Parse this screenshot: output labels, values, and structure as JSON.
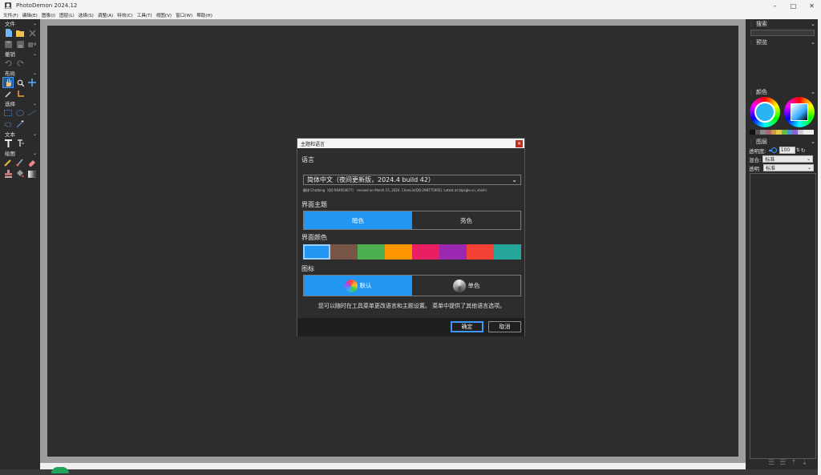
{
  "window": {
    "title": "PhotoDemon 2024.12",
    "controls": [
      "minimize-icon",
      "maximize-icon",
      "close-icon"
    ]
  },
  "menu": [
    "文件(F)",
    "编辑(E)",
    "图像(I)",
    "图层(L)",
    "选择(S)",
    "调整(A)",
    "特效(C)",
    "工具(T)",
    "视图(V)",
    "窗口(W)",
    "帮助(H)"
  ],
  "toolbox": {
    "sections": {
      "file": "文件",
      "undo": "撤销",
      "layout": "布局",
      "select": "选择",
      "text": "文本",
      "paint": "绘图"
    }
  },
  "right_panel": {
    "search_label": "搜索",
    "preview_label": "预览",
    "color_label": "颜色",
    "layers_label": "图层",
    "opacity_label": "透明度:",
    "opacity_value": "100",
    "blend_label": "混合:",
    "blend_value": "标准",
    "alpha_label": "透明",
    "alpha_value": "标准"
  },
  "dialog": {
    "title": "主题和语言",
    "close_icon": "close-icon",
    "language_label": "语言",
    "language_value": "简体中文（夜间更新版，2024.4 build 42）",
    "credits": "翻译 Chatbing（QQ 964954677） revised on March 15, 2024. ChenLin(QQ:298775905). Latest at blpsgle.cn, shishi",
    "theme_label": "界面主题",
    "theme_options": [
      "暗色",
      "亮色"
    ],
    "theme_selected": "暗色",
    "accent_label": "界面颜色",
    "accent_colors": [
      "#2196f3",
      "#795548",
      "#4caf50",
      "#ff9800",
      "#e91e63",
      "#9c27b0",
      "#f44336",
      "#26a69a"
    ],
    "icons_label": "图标",
    "icon_options": [
      "默认",
      "单色"
    ],
    "icon_selected": "默认",
    "hint": "您可以随时在工具菜单更改语言和主题设置。 菜单中提供了其他语言选项。",
    "ok_label": "确定",
    "cancel_label": "取消"
  },
  "colors": {
    "accent": "#2196f3",
    "canvas_bg": "#2d2d2d",
    "panel_bg": "#2b2b2b"
  }
}
